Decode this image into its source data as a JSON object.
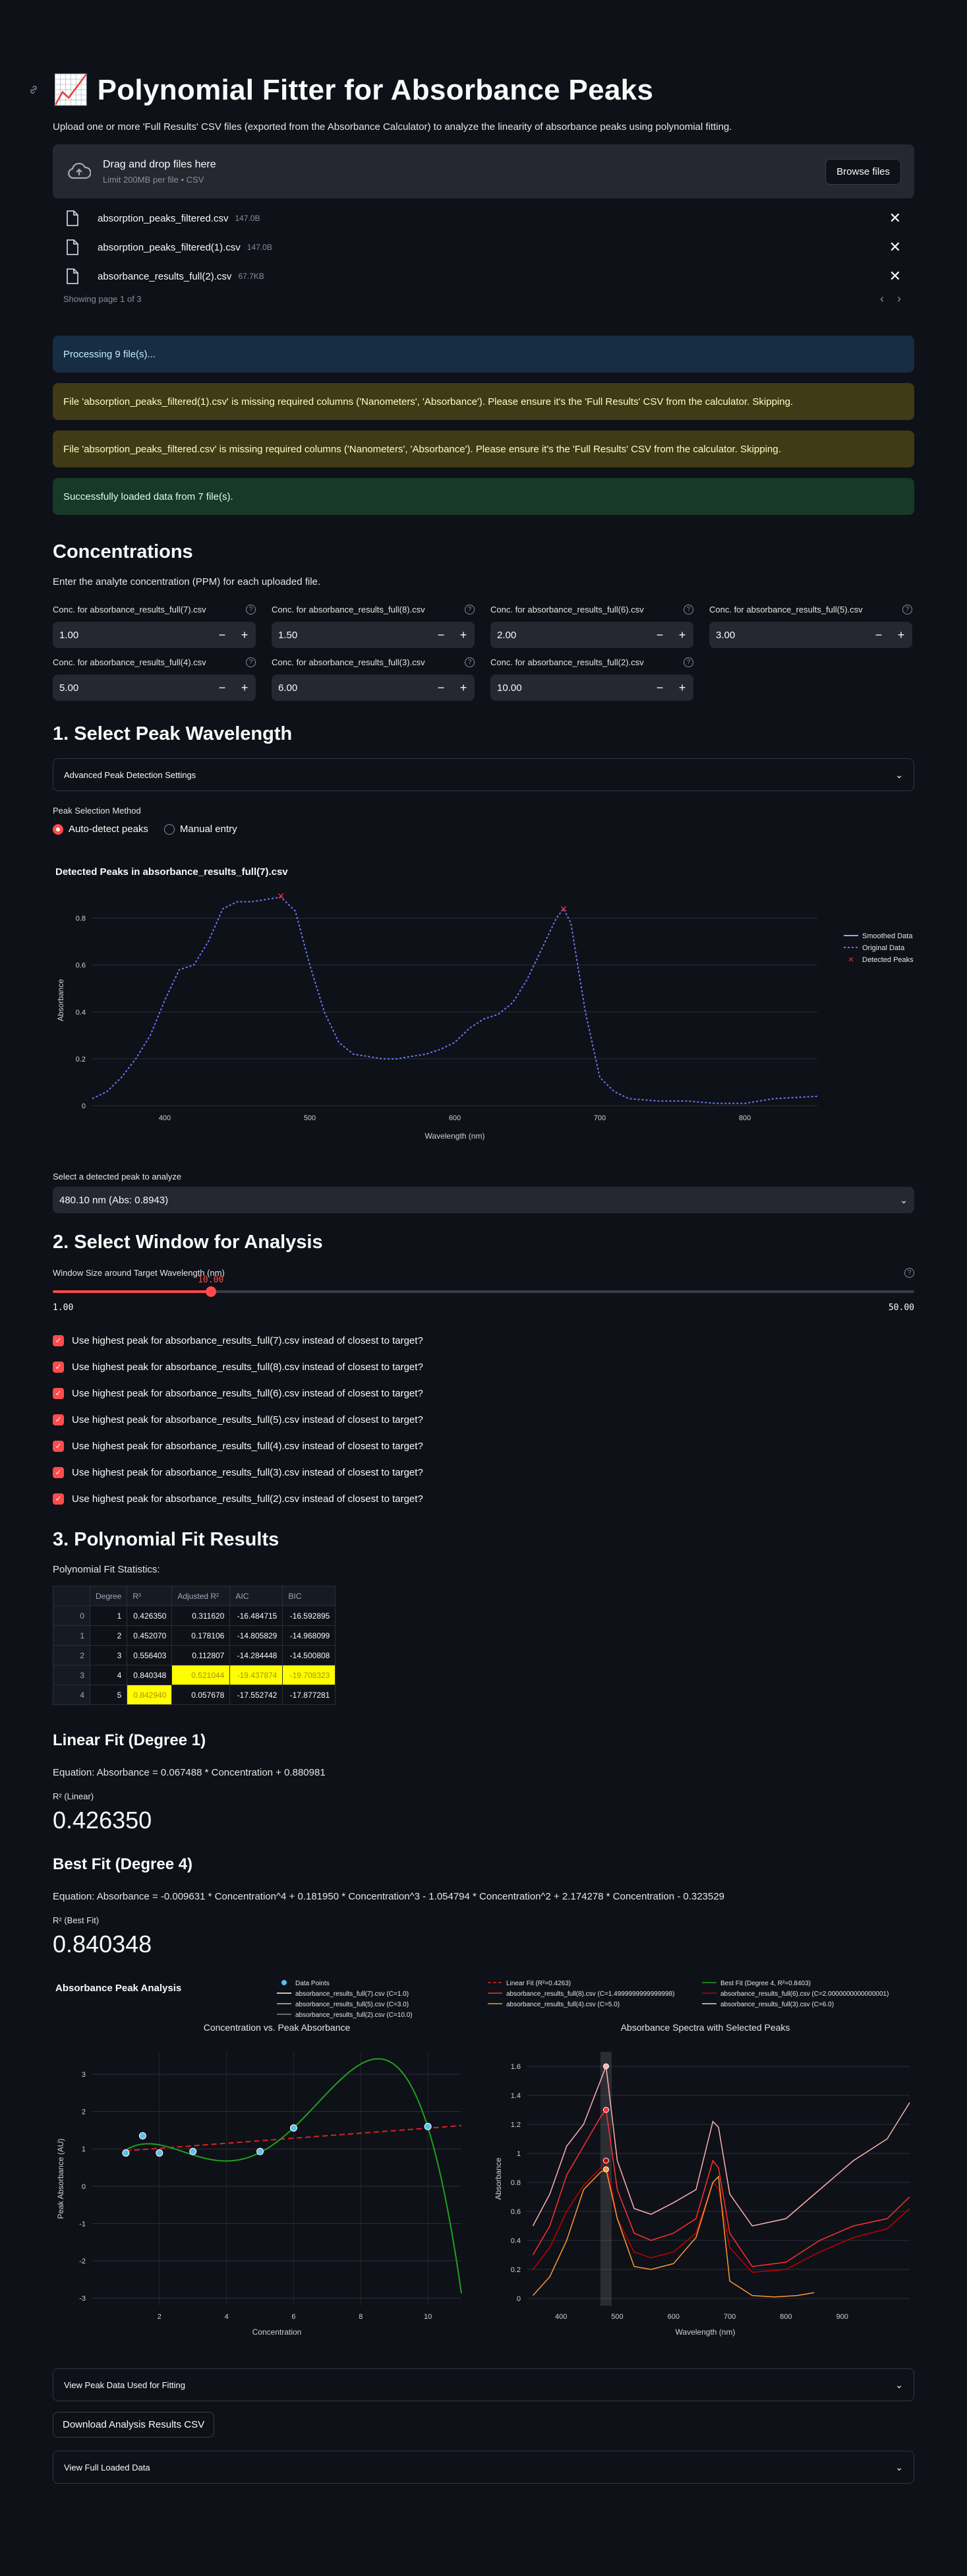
{
  "header": {
    "title": "📈 Polynomial Fitter for Absorbance Peaks",
    "subtitle": "Upload one or more 'Full Results' CSV files (exported from the Absorbance Calculator) to analyze the linearity of absorbance peaks using polynomial fitting."
  },
  "uploader": {
    "drag_text": "Drag and drop files here",
    "limit_text": "Limit 200MB per file • CSV",
    "browse_label": "Browse files",
    "files": [
      {
        "name": "absorption_peaks_filtered.csv",
        "size": "147.0B"
      },
      {
        "name": "absorption_peaks_filtered(1).csv",
        "size": "147.0B"
      },
      {
        "name": "absorbance_results_full(2).csv",
        "size": "67.7KB"
      }
    ],
    "pager_text": "Showing page 1 of 3"
  },
  "alerts": {
    "processing": "Processing 9 file(s)...",
    "warn1": "File 'absorption_peaks_filtered(1).csv' is missing required columns ('Nanometers', 'Absorbance'). Please ensure it's the 'Full Results' CSV from the calculator. Skipping.",
    "warn2": "File 'absorption_peaks_filtered.csv' is missing required columns ('Nanometers', 'Absorbance'). Please ensure it's the 'Full Results' CSV from the calculator. Skipping.",
    "success": "Successfully loaded data from 7 file(s)."
  },
  "concentrations": {
    "heading": "Concentrations",
    "description": "Enter the analyte concentration (PPM) for each uploaded file.",
    "inputs": [
      {
        "label": "Conc. for absorbance_results_full(7).csv",
        "value": "1.00"
      },
      {
        "label": "Conc. for absorbance_results_full(8).csv",
        "value": "1.50"
      },
      {
        "label": "Conc. for absorbance_results_full(6).csv",
        "value": "2.00"
      },
      {
        "label": "Conc. for absorbance_results_full(5).csv",
        "value": "3.00"
      },
      {
        "label": "Conc. for absorbance_results_full(4).csv",
        "value": "5.00"
      },
      {
        "label": "Conc. for absorbance_results_full(3).csv",
        "value": "6.00"
      },
      {
        "label": "Conc. for absorbance_results_full(2).csv",
        "value": "10.00"
      }
    ]
  },
  "peak_section": {
    "heading": "1. Select Peak Wavelength",
    "advanced_label": "Advanced Peak Detection Settings",
    "method_label": "Peak Selection Method",
    "method_options": [
      "Auto-detect peaks",
      "Manual entry"
    ],
    "chart_title": "Detected Peaks in absorbance_results_full(7).csv",
    "select_label": "Select a detected peak to analyze",
    "select_value": "480.10 nm (Abs: 0.8943)"
  },
  "window_section": {
    "heading": "2. Select Window for Analysis",
    "slider_label": "Window Size around Target Wavelength (nm)",
    "slider_value": "10.00",
    "slider_min": "1.00",
    "slider_max": "50.00",
    "slider_fraction": 0.1837,
    "checks": [
      "Use highest peak for absorbance_results_full(7).csv instead of closest to target?",
      "Use highest peak for absorbance_results_full(8).csv instead of closest to target?",
      "Use highest peak for absorbance_results_full(6).csv instead of closest to target?",
      "Use highest peak for absorbance_results_full(5).csv instead of closest to target?",
      "Use highest peak for absorbance_results_full(4).csv instead of closest to target?",
      "Use highest peak for absorbance_results_full(3).csv instead of closest to target?",
      "Use highest peak for absorbance_results_full(2).csv instead of closest to target?"
    ]
  },
  "results": {
    "heading": "3. Polynomial Fit Results",
    "stats_label": "Polynomial Fit Statistics:",
    "columns": [
      "",
      "Degree",
      "R²",
      "Adjusted R²",
      "AIC",
      "BIC"
    ],
    "rows": [
      [
        "0",
        "1",
        "0.426350",
        "0.311620",
        "-16.484715",
        "-16.592895"
      ],
      [
        "1",
        "2",
        "0.452070",
        "0.178106",
        "-14.805829",
        "-14.968099"
      ],
      [
        "2",
        "3",
        "0.556403",
        "0.112807",
        "-14.284448",
        "-14.500808"
      ],
      [
        "3",
        "4",
        "0.840348",
        "0.521044",
        "-19.437874",
        "-19.708323"
      ],
      [
        "4",
        "5",
        "0.842940",
        "0.057678",
        "-17.552742",
        "-17.877281"
      ]
    ],
    "linear_heading": "Linear Fit (Degree 1)",
    "linear_equation": "Equation: Absorbance = 0.067488 * Concentration + 0.880981",
    "linear_r2_label": "R² (Linear)",
    "linear_r2_value": "0.426350",
    "best_heading": "Best Fit (Degree 4)",
    "best_equation": "Equation: Absorbance = -0.009631 * Concentration^4 + 0.181950 * Concentration^3 - 1.054794 * Concentration^2 + 2.174278 * Concentration - 0.323529",
    "best_r2_label": "R² (Best Fit)",
    "best_r2_value": "0.840348"
  },
  "analysis_figure": {
    "suptitle": "Absorbance Peak Analysis",
    "left_title": "Concentration vs. Peak Absorbance",
    "left_xlabel": "Concentration",
    "left_ylabel": "Peak Absorbance (AU)",
    "right_title": "Absorbance Spectra with Selected Peaks",
    "right_xlabel": "Wavelength (nm)",
    "right_ylabel": "Absorbance",
    "legend": [
      "Data Points",
      "absorbance_results_full(7).csv (C=1.0)",
      "absorbance_results_full(5).csv (C=3.0)",
      "absorbance_results_full(2).csv (C=10.0)",
      "Linear Fit (R²=0.4263)",
      "absorbance_results_full(8).csv (C=1.4999999999999998)",
      "absorbance_results_full(4).csv (C=5.0)",
      "Best Fit (Degree 4, R²=0.8403)",
      "absorbance_results_full(6).csv (C=2.0000000000000001)",
      "absorbance_results_full(3).csv (C=6.0)"
    ]
  },
  "footer": {
    "peak_data_label": "View Peak Data Used for Fitting",
    "download_label": "Download Analysis Results CSV",
    "loaded_label": "View Full Loaded Data"
  },
  "colors": {
    "accent": "#ff4b4b",
    "background": "#0e1117",
    "widget": "#262730",
    "info": "#172d43",
    "warning": "#3e3b16",
    "success": "#173928"
  },
  "chart_data": [
    {
      "type": "line",
      "title": "Detected Peaks in absorbance_results_full(7).csv",
      "xlabel": "Wavelength (nm)",
      "ylabel": "Absorbance",
      "xlim": [
        350,
        850
      ],
      "ylim": [
        0,
        0.9
      ],
      "xticks": [
        400,
        500,
        600,
        700,
        800
      ],
      "yticks": [
        0,
        0.2,
        0.4,
        0.6,
        0.8
      ],
      "legend": [
        "Smoothed Data",
        "Original Data",
        "Detected Peaks"
      ],
      "series": [
        {
          "name": "Original Data",
          "x": [
            350,
            360,
            370,
            380,
            390,
            400,
            410,
            420,
            430,
            440,
            450,
            460,
            470,
            480,
            490,
            500,
            510,
            520,
            530,
            540,
            550,
            560,
            570,
            580,
            590,
            600,
            610,
            620,
            630,
            640,
            650,
            660,
            670,
            675,
            680,
            690,
            700,
            710,
            720,
            740,
            760,
            780,
            800,
            820,
            850
          ],
          "y": [
            0.03,
            0.06,
            0.12,
            0.2,
            0.3,
            0.45,
            0.58,
            0.6,
            0.7,
            0.84,
            0.87,
            0.87,
            0.88,
            0.89,
            0.83,
            0.6,
            0.4,
            0.27,
            0.22,
            0.21,
            0.2,
            0.2,
            0.21,
            0.22,
            0.24,
            0.27,
            0.33,
            0.37,
            0.39,
            0.44,
            0.54,
            0.67,
            0.8,
            0.84,
            0.78,
            0.4,
            0.12,
            0.06,
            0.03,
            0.02,
            0.02,
            0.01,
            0.01,
            0.03,
            0.04
          ]
        }
      ],
      "peaks": {
        "x": [
          480.1,
          675
        ],
        "y": [
          0.8943,
          0.84
        ]
      }
    },
    {
      "type": "scatter",
      "title": "Concentration vs. Peak Absorbance",
      "xlabel": "Concentration",
      "ylabel": "Peak Absorbance (AU)",
      "xlim": [
        0,
        11
      ],
      "ylim": [
        -3.2,
        3.6
      ],
      "xticks": [
        2,
        4,
        6,
        8,
        10
      ],
      "yticks": [
        -3,
        -2,
        -1,
        0,
        1,
        2,
        3
      ],
      "points": {
        "x": [
          1.0,
          1.5,
          2.0,
          3.0,
          5.0,
          6.0,
          10.0
        ],
        "y": [
          0.89,
          1.35,
          0.89,
          0.93,
          0.93,
          1.56,
          1.6
        ]
      },
      "linear_fit": {
        "slope": 0.067488,
        "intercept": 0.880981
      },
      "best_fit": {
        "coefficients": [
          -0.009631,
          0.18195,
          -1.054794,
          2.174278,
          -0.323529
        ]
      }
    },
    {
      "type": "line",
      "title": "Absorbance Spectra with Selected Peaks",
      "xlabel": "Wavelength (nm)",
      "ylabel": "Absorbance",
      "xlim": [
        340,
        1020
      ],
      "ylim": [
        -0.05,
        1.7
      ],
      "xticks": [
        400,
        500,
        600,
        700,
        800,
        900
      ],
      "yticks": [
        0,
        0.2,
        0.4,
        0.6,
        0.8,
        1,
        1.2,
        1.4,
        1.6
      ],
      "highlight_band": [
        470,
        490
      ],
      "series": [
        {
          "name": "absorbance_results_full(2).csv (C=10.0)",
          "color": "#ffb0b0",
          "x": [
            350,
            380,
            410,
            440,
            470,
            480,
            500,
            530,
            560,
            600,
            640,
            670,
            680,
            700,
            740,
            800,
            860,
            920,
            980,
            1020
          ],
          "y": [
            0.5,
            0.72,
            1.05,
            1.2,
            1.5,
            1.6,
            0.95,
            0.62,
            0.58,
            0.66,
            0.75,
            1.22,
            1.18,
            0.72,
            0.5,
            0.55,
            0.75,
            0.95,
            1.1,
            1.35
          ]
        },
        {
          "name": "absorbance_results_full(8).csv (C=1.4999999999999998)",
          "color": "#ff3030",
          "x": [
            350,
            380,
            410,
            440,
            470,
            480,
            500,
            530,
            560,
            600,
            640,
            670,
            680,
            700,
            740,
            800,
            860,
            920,
            980,
            1020
          ],
          "y": [
            0.3,
            0.5,
            0.85,
            1.05,
            1.25,
            1.3,
            0.75,
            0.45,
            0.4,
            0.45,
            0.55,
            0.95,
            0.9,
            0.45,
            0.22,
            0.25,
            0.4,
            0.5,
            0.55,
            0.7
          ]
        },
        {
          "name": "absorbance_results_full(6).csv (C=2.0000000000000001)",
          "color": "#c00000",
          "x": [
            350,
            380,
            410,
            440,
            470,
            480,
            500,
            530,
            560,
            600,
            640,
            670,
            680,
            700,
            740,
            800,
            860,
            920,
            980,
            1020
          ],
          "y": [
            0.2,
            0.35,
            0.6,
            0.78,
            0.9,
            0.95,
            0.55,
            0.32,
            0.28,
            0.32,
            0.45,
            0.8,
            0.76,
            0.35,
            0.18,
            0.2,
            0.32,
            0.42,
            0.48,
            0.62
          ]
        },
        {
          "name": "absorbance_results_full(7).csv (C=1.0)",
          "color": "#ff9933",
          "x": [
            350,
            380,
            410,
            440,
            470,
            480,
            500,
            530,
            560,
            600,
            640,
            670,
            680,
            700,
            740,
            780,
            820,
            850
          ],
          "y": [
            0.02,
            0.15,
            0.4,
            0.75,
            0.87,
            0.89,
            0.55,
            0.22,
            0.2,
            0.24,
            0.42,
            0.8,
            0.84,
            0.12,
            0.02,
            0.01,
            0.02,
            0.04
          ]
        }
      ]
    }
  ]
}
